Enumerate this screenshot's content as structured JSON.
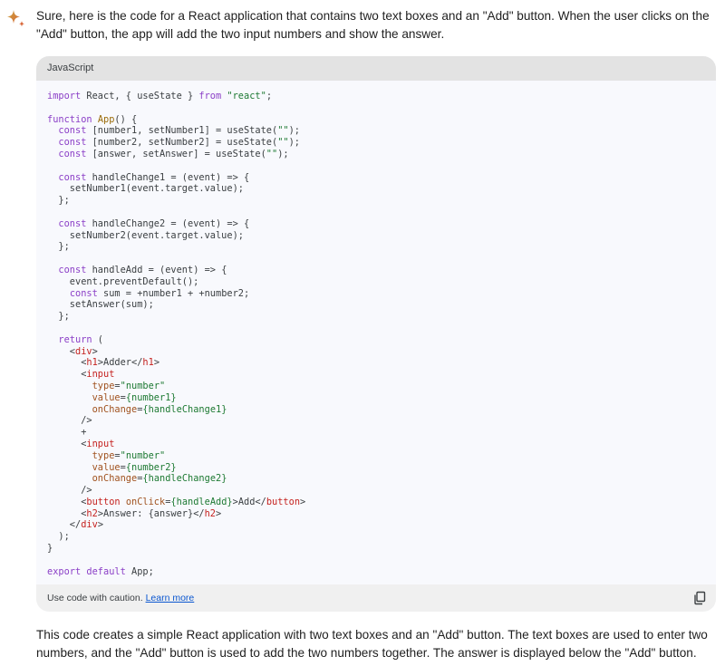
{
  "response": {
    "intro": "Sure, here is the code for a React application that contains two text boxes and an \"Add\" button. When the user clicks on the \"Add\" button, the app will add the two input numbers and show the answer.",
    "outro": "This code creates a simple React application with two text boxes and an \"Add\" button. The text boxes are used to enter two numbers, and the \"Add\" button is used to add the two numbers together. The answer is displayed below the \"Add\" button."
  },
  "code_block": {
    "language": "JavaScript",
    "lines": [
      [
        [
          "kw",
          "import"
        ],
        [
          "p",
          " React, { useState } "
        ],
        [
          "kw",
          "from"
        ],
        [
          "p",
          " "
        ],
        [
          "str",
          "\"react\""
        ],
        [
          "p",
          ";"
        ]
      ],
      [],
      [
        [
          "kw",
          "function"
        ],
        [
          "p",
          " "
        ],
        [
          "fn",
          "App"
        ],
        [
          "p",
          "() {"
        ]
      ],
      [
        [
          "p",
          "  "
        ],
        [
          "kw",
          "const"
        ],
        [
          "p",
          " [number1, setNumber1] = useState("
        ],
        [
          "str",
          "\"\""
        ],
        [
          "p",
          ");"
        ]
      ],
      [
        [
          "p",
          "  "
        ],
        [
          "kw",
          "const"
        ],
        [
          "p",
          " [number2, setNumber2] = useState("
        ],
        [
          "str",
          "\"\""
        ],
        [
          "p",
          ");"
        ]
      ],
      [
        [
          "p",
          "  "
        ],
        [
          "kw",
          "const"
        ],
        [
          "p",
          " [answer, setAnswer] = useState("
        ],
        [
          "str",
          "\"\""
        ],
        [
          "p",
          ");"
        ]
      ],
      [],
      [
        [
          "p",
          "  "
        ],
        [
          "kw",
          "const"
        ],
        [
          "p",
          " handleChange1 = (event) => {"
        ]
      ],
      [
        [
          "p",
          "    setNumber1(event.target.value);"
        ]
      ],
      [
        [
          "p",
          "  };"
        ]
      ],
      [],
      [
        [
          "p",
          "  "
        ],
        [
          "kw",
          "const"
        ],
        [
          "p",
          " handleChange2 = (event) => {"
        ]
      ],
      [
        [
          "p",
          "    setNumber2(event.target.value);"
        ]
      ],
      [
        [
          "p",
          "  };"
        ]
      ],
      [],
      [
        [
          "p",
          "  "
        ],
        [
          "kw",
          "const"
        ],
        [
          "p",
          " handleAdd = (event) => {"
        ]
      ],
      [
        [
          "p",
          "    event.preventDefault();"
        ]
      ],
      [
        [
          "p",
          "    "
        ],
        [
          "kw",
          "const"
        ],
        [
          "p",
          " sum = +number1 + +number2;"
        ]
      ],
      [
        [
          "p",
          "    setAnswer(sum);"
        ]
      ],
      [
        [
          "p",
          "  };"
        ]
      ],
      [],
      [
        [
          "p",
          "  "
        ],
        [
          "kw",
          "return"
        ],
        [
          "p",
          " ("
        ]
      ],
      [
        [
          "p",
          "    <"
        ],
        [
          "tag",
          "div"
        ],
        [
          "p",
          ">"
        ]
      ],
      [
        [
          "p",
          "      <"
        ],
        [
          "tag",
          "h1"
        ],
        [
          "p",
          ">Adder</"
        ],
        [
          "tag",
          "h1"
        ],
        [
          "p",
          ">"
        ]
      ],
      [
        [
          "p",
          "      <"
        ],
        [
          "tag",
          "input"
        ]
      ],
      [
        [
          "p",
          "        "
        ],
        [
          "attr",
          "type"
        ],
        [
          "p",
          "="
        ],
        [
          "str",
          "\"number\""
        ]
      ],
      [
        [
          "p",
          "        "
        ],
        [
          "attr",
          "value"
        ],
        [
          "p",
          "="
        ],
        [
          "expr",
          "{number1}"
        ]
      ],
      [
        [
          "p",
          "        "
        ],
        [
          "attr",
          "onChange"
        ],
        [
          "p",
          "="
        ],
        [
          "expr",
          "{handleChange1}"
        ]
      ],
      [
        [
          "p",
          "      />"
        ]
      ],
      [
        [
          "p",
          "      +"
        ]
      ],
      [
        [
          "p",
          "      <"
        ],
        [
          "tag",
          "input"
        ]
      ],
      [
        [
          "p",
          "        "
        ],
        [
          "attr",
          "type"
        ],
        [
          "p",
          "="
        ],
        [
          "str",
          "\"number\""
        ]
      ],
      [
        [
          "p",
          "        "
        ],
        [
          "attr",
          "value"
        ],
        [
          "p",
          "="
        ],
        [
          "expr",
          "{number2}"
        ]
      ],
      [
        [
          "p",
          "        "
        ],
        [
          "attr",
          "onChange"
        ],
        [
          "p",
          "="
        ],
        [
          "expr",
          "{handleChange2}"
        ]
      ],
      [
        [
          "p",
          "      />"
        ]
      ],
      [
        [
          "p",
          "      <"
        ],
        [
          "tag",
          "button"
        ],
        [
          "p",
          " "
        ],
        [
          "attr",
          "onClick"
        ],
        [
          "p",
          "="
        ],
        [
          "expr",
          "{handleAdd}"
        ],
        [
          "p",
          ">Add</"
        ],
        [
          "tag",
          "button"
        ],
        [
          "p",
          ">"
        ]
      ],
      [
        [
          "p",
          "      <"
        ],
        [
          "tag",
          "h2"
        ],
        [
          "p",
          ">Answer: {answer}</"
        ],
        [
          "tag",
          "h2"
        ],
        [
          "p",
          ">"
        ]
      ],
      [
        [
          "p",
          "    </"
        ],
        [
          "tag",
          "div"
        ],
        [
          "p",
          ">"
        ]
      ],
      [
        [
          "p",
          "  );"
        ]
      ],
      [
        [
          "p",
          "}"
        ]
      ],
      [],
      [
        [
          "kw",
          "export"
        ],
        [
          "p",
          " "
        ],
        [
          "kw",
          "default"
        ],
        [
          "p",
          " App;"
        ]
      ]
    ],
    "footer_text": "Use code with caution. ",
    "footer_link": "Learn more",
    "copy_icon": "copy-icon"
  },
  "colors": {
    "keyword": "#8b3fc7",
    "string": "#1e7a33",
    "tag": "#c5221f",
    "attribute": "#a0521f",
    "function_name": "#9a6a07",
    "link": "#0b57d0"
  }
}
